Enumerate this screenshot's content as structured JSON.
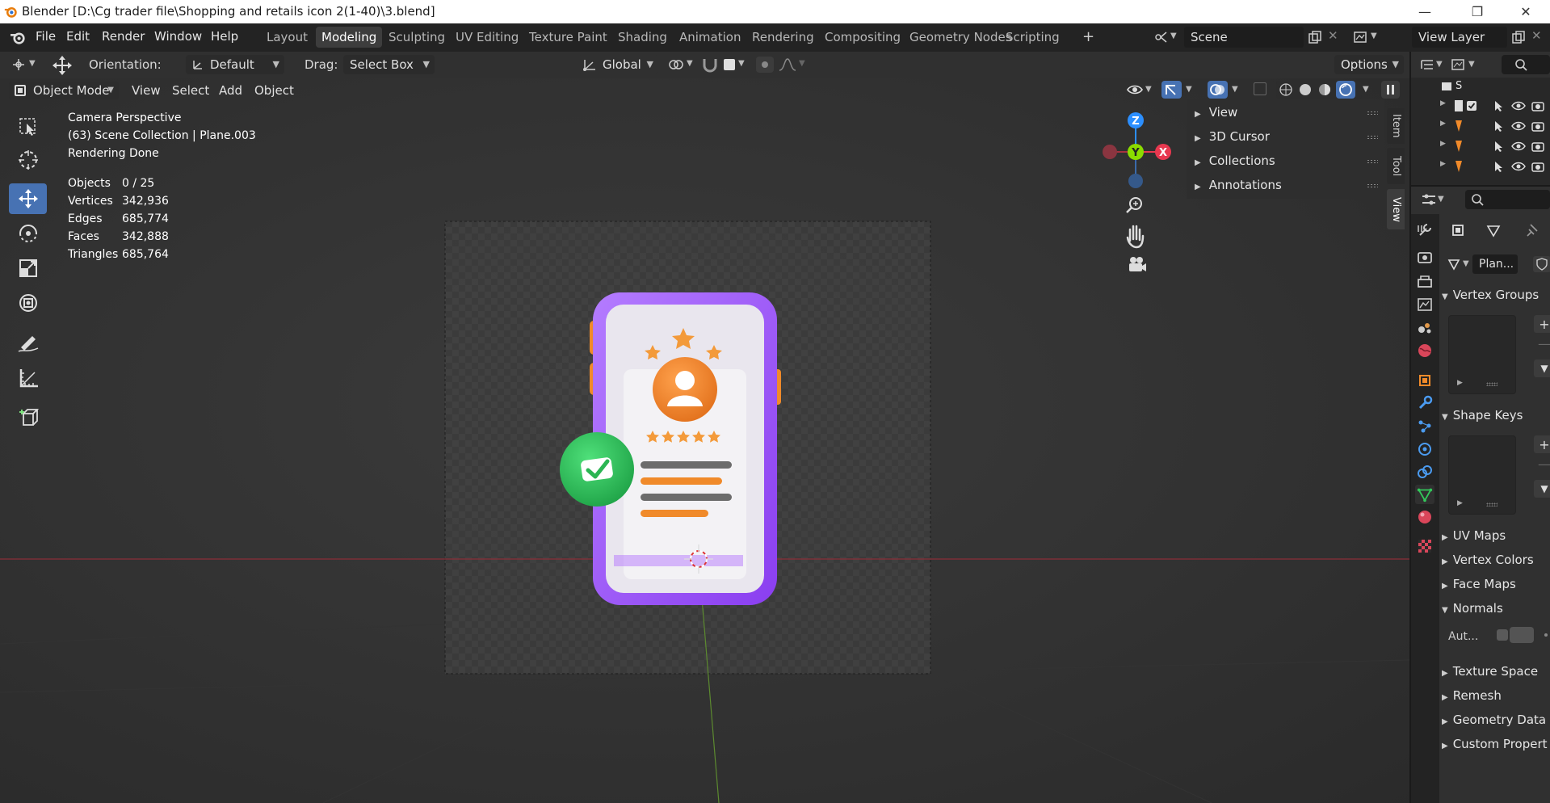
{
  "window": {
    "title": "Blender [D:\\Cg trader file\\Shopping and retails icon 2(1-40)\\3.blend]",
    "controls": [
      "—",
      "❐",
      "✕"
    ]
  },
  "menu": [
    "File",
    "Edit",
    "Render",
    "Window",
    "Help"
  ],
  "workspaces": {
    "tabs": [
      "Layout",
      "Modeling",
      "Sculpting",
      "UV Editing",
      "Texture Paint",
      "Shading",
      "Animation",
      "Rendering",
      "Compositing",
      "Geometry Nodes",
      "Scripting"
    ],
    "active": "Modeling",
    "add": "+"
  },
  "scene": {
    "name": "Scene",
    "view_layer": "View Layer"
  },
  "tool_header": {
    "orientation_label": "Orientation:",
    "orientation_value": "Default",
    "drag_label": "Drag:",
    "drag_value": "Select Box",
    "transform_orientation": "Global",
    "options": "Options"
  },
  "viewport_header": {
    "mode": "Object Mode",
    "menus": [
      "View",
      "Select",
      "Add",
      "Object"
    ]
  },
  "overlay_info": {
    "line1": "Camera Perspective",
    "line2": "(63) Scene Collection | Plane.003",
    "line3": "Rendering Done",
    "stats": [
      {
        "label": "Objects",
        "value": "0 / 25"
      },
      {
        "label": "Vertices",
        "value": "342,936"
      },
      {
        "label": "Edges",
        "value": "685,774"
      },
      {
        "label": "Faces",
        "value": "342,888"
      },
      {
        "label": "Triangles",
        "value": "685,764"
      }
    ]
  },
  "gizmo": {
    "z": "Z",
    "y": "Y",
    "x": "X"
  },
  "npanel": {
    "items": [
      "View",
      "3D Cursor",
      "Collections",
      "Annotations"
    ],
    "tabs": [
      "Item",
      "Tool",
      "View"
    ],
    "active_tab": "View"
  },
  "outliner": {
    "header": "S"
  },
  "properties": {
    "mesh_name": "Plan...",
    "sections": [
      {
        "label": "Vertex Groups",
        "open": true
      },
      {
        "label": "Shape Keys",
        "open": true
      },
      {
        "label": "UV Maps",
        "open": false
      },
      {
        "label": "Vertex Colors",
        "open": false
      },
      {
        "label": "Face Maps",
        "open": false
      },
      {
        "label": "Normals",
        "open": true
      },
      {
        "label": "Texture Space",
        "open": false
      },
      {
        "label": "Remesh",
        "open": false
      },
      {
        "label": "Geometry Data",
        "open": false
      },
      {
        "label": "Custom Propert",
        "open": false
      }
    ],
    "normals_auto": "Aut..."
  },
  "colors": {
    "accent": "#4772b3",
    "gizmo_x": "#e8384f",
    "gizmo_y": "#8bdc00",
    "gizmo_z": "#2c8fff",
    "phone_purple": "#9b4dff",
    "orange": "#f08a2a",
    "green": "#32c85a"
  }
}
